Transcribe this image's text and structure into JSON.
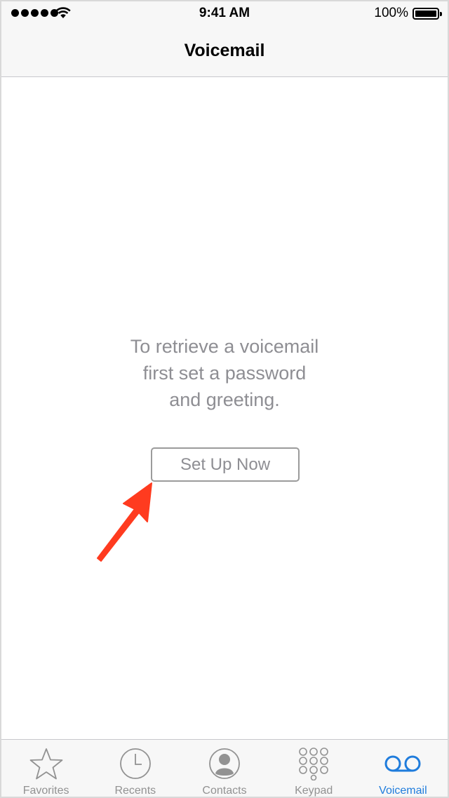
{
  "status_bar": {
    "time": "9:41 AM",
    "battery_percent": "100%",
    "signal_icon": "signal-dots-icon",
    "wifi_icon": "wifi-icon",
    "battery_icon": "battery-icon"
  },
  "nav": {
    "title": "Voicemail"
  },
  "main": {
    "message_lines": [
      "To retrieve a voicemail",
      "first set a password",
      "and greeting."
    ],
    "setup_button_label": "Set Up Now",
    "annotation_icon": "red-arrow-icon"
  },
  "tab_bar": {
    "active": "Voicemail",
    "tabs": [
      {
        "label": "Favorites",
        "icon": "star-icon"
      },
      {
        "label": "Recents",
        "icon": "clock-icon"
      },
      {
        "label": "Contacts",
        "icon": "contact-icon"
      },
      {
        "label": "Keypad",
        "icon": "keypad-icon"
      },
      {
        "label": "Voicemail",
        "icon": "voicemail-icon"
      }
    ]
  },
  "colors": {
    "accent": "#1f7cdc",
    "secondary_text": "#8e8e93",
    "annotation_arrow": "#ff3b1f"
  }
}
